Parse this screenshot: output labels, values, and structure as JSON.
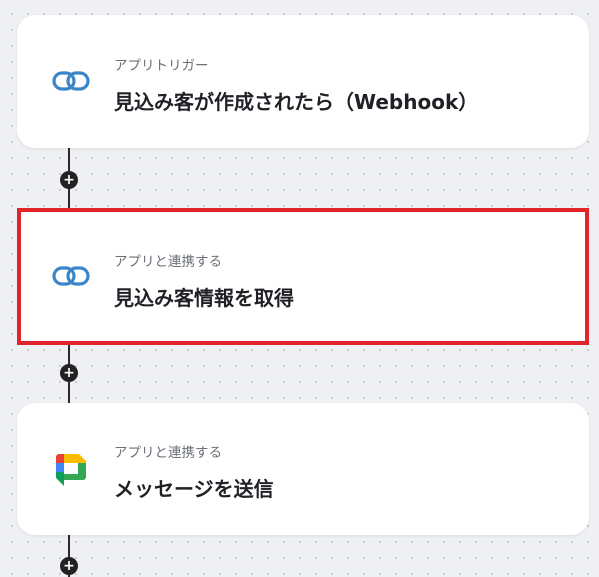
{
  "flow": {
    "steps": [
      {
        "subtitle": "アプリトリガー",
        "title": "見込み客が作成されたら（Webhook）",
        "icon": "link-chain-icon"
      },
      {
        "subtitle": "アプリと連携する",
        "title": "見込み客情報を取得",
        "icon": "link-chain-icon",
        "selected": true
      },
      {
        "subtitle": "アプリと連携する",
        "title": "メッセージを送信",
        "icon": "google-chat-icon"
      }
    ],
    "add_step_label": "+"
  },
  "colors": {
    "selection_border": "#e2252b",
    "link_icon": "#3a86c8",
    "connector": "#2a2a2a"
  }
}
